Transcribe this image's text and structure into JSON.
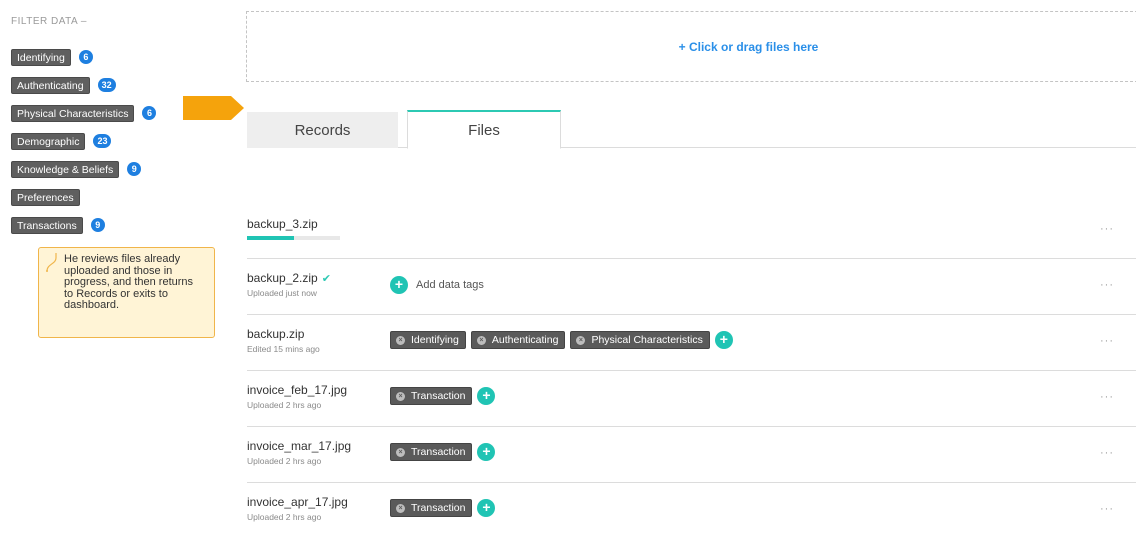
{
  "sidebar": {
    "filter_title": "FILTER DATA  –",
    "filters": [
      {
        "label": "Identifying",
        "count": "6"
      },
      {
        "label": "Authenticating",
        "count": "32"
      },
      {
        "label": "Physical Characteristics",
        "count": "6"
      },
      {
        "label": "Demographic",
        "count": "23"
      },
      {
        "label": "Knowledge & Beliefs",
        "count": "9"
      },
      {
        "label": "Preferences",
        "count": ""
      },
      {
        "label": "Transactions",
        "count": "9"
      }
    ],
    "note": "He reviews files already uploaded and those in progress, and then returns to Records or exits to dashboard."
  },
  "upload": {
    "label": "+ Click or drag files here"
  },
  "tabs": {
    "records": "Records",
    "files": "Files"
  },
  "files": [
    {
      "name": "backup_3.zip",
      "status": "",
      "progress": 0.5,
      "tags": [],
      "add_label": ""
    },
    {
      "name": "backup_2.zip",
      "status": "Uploaded just now",
      "check": "✔",
      "tags": [],
      "add_label": "Add data tags"
    },
    {
      "name": "backup.zip",
      "status": "Edited 15 mins ago",
      "tags": [
        "Identifying",
        "Authenticating",
        "Physical Characteristics"
      ]
    },
    {
      "name": "invoice_feb_17.jpg",
      "status": "Uploaded 2 hrs ago",
      "tags": [
        "Transaction"
      ]
    },
    {
      "name": "invoice_mar_17.jpg",
      "status": "Uploaded 2 hrs ago",
      "tags": [
        "Transaction"
      ]
    },
    {
      "name": "invoice_apr_17.jpg",
      "status": "Uploaded 2 hrs ago",
      "tags": [
        "Transaction"
      ]
    }
  ],
  "icons": {
    "more": "···",
    "add": "+",
    "remove": "×"
  },
  "colors": {
    "accent": "#20c4b4",
    "badge": "#1e7fe0",
    "arrow": "#f5a30c",
    "link": "#2a8fe8"
  }
}
